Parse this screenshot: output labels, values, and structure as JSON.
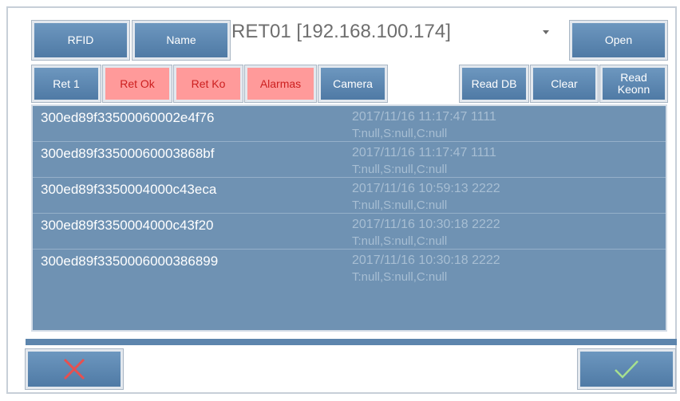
{
  "header": {
    "rfid_label": "RFID",
    "name_label": "Name",
    "device_selected": "RET01 [192.168.100.174]",
    "open_label": "Open"
  },
  "toolbar": {
    "ret1_label": "Ret 1",
    "ret_ok_label": "Ret Ok",
    "ret_ko_label": "Ret Ko",
    "alarmas_label": "Alarmas",
    "camera_label": "Camera",
    "read_db_label": "Read DB",
    "clear_label": "Clear",
    "read_keonn_label": "Read Keonn"
  },
  "rows": [
    {
      "id": "300ed89f33500060002e4f76",
      "timestamp": "2017/11/16 11:17:47 1111",
      "info": "T:null,S:null,C:null"
    },
    {
      "id": "300ed89f33500060003868bf",
      "timestamp": "2017/11/16 11:17:47 1111",
      "info": "T:null,S:null,C:null"
    },
    {
      "id": "300ed89f3350004000c43eca",
      "timestamp": "2017/11/16 10:59:13 2222",
      "info": "T:null,S:null,C:null"
    },
    {
      "id": "300ed89f3350004000c43f20",
      "timestamp": "2017/11/16 10:30:18 2222",
      "info": "T:null,S:null,C:null"
    },
    {
      "id": "300ed89f3350006000386899",
      "timestamp": "2017/11/16 10:30:18 2222",
      "info": "T:null,S:null,C:null"
    }
  ],
  "colors": {
    "button_blue": "#5b86b0",
    "button_red": "#ff9a9a",
    "list_bg": "#6f92b3",
    "cancel_icon": "#e8504f",
    "confirm_icon": "#a6e08f"
  },
  "icons": {
    "cancel": "close-icon",
    "confirm": "check-icon",
    "dropdown": "chevron-down-icon"
  }
}
